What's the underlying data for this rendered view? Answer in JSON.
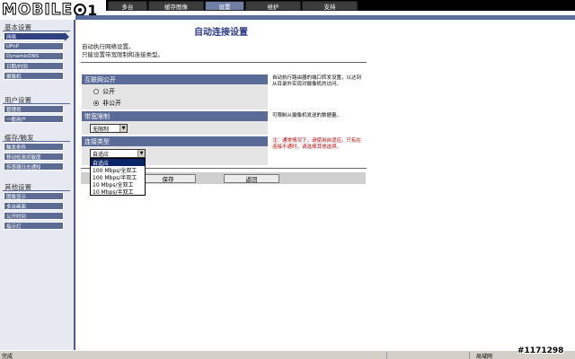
{
  "header": {
    "logo_text": "MOBILE",
    "logo_digit": "1",
    "tabs": [
      {
        "label": "多台"
      },
      {
        "label": "缓存图像"
      },
      {
        "label": "设置"
      },
      {
        "label": "维护"
      },
      {
        "label": "支持"
      }
    ]
  },
  "sidebar": {
    "sections": [
      {
        "title": "基本设置",
        "items": [
          {
            "label": "网络"
          },
          {
            "label": "UPnP"
          },
          {
            "label": "DynamicDNS"
          },
          {
            "label": "日期/时间"
          },
          {
            "label": "摄像机"
          }
        ]
      },
      {
        "title": "用户设置",
        "items": [
          {
            "label": "管理员"
          },
          {
            "label": "一般用户"
          }
        ]
      },
      {
        "title": "缓存/触发",
        "items": [
          {
            "label": "触发条件"
          },
          {
            "label": "移动检测灵敏度"
          },
          {
            "label": "传感器日志通知"
          }
        ]
      },
      {
        "title": "其他设置",
        "items": [
          {
            "label": "图像显示"
          },
          {
            "label": "多台画面"
          },
          {
            "label": "公开时间"
          },
          {
            "label": "指示灯"
          }
        ]
      }
    ]
  },
  "main": {
    "title": "自动连接设置",
    "desc1": "自动执行网络设置。",
    "desc2": "只能设置带宽限制和连接类型。",
    "public": {
      "header": "互联网公开",
      "options": [
        "公开",
        "非公开"
      ],
      "selected": "非公开",
      "help": "自动执行路由器的端口转发设置，以达到从目录外实现对摄像机的访问。"
    },
    "bandwidth": {
      "header": "带宽限制",
      "value": "无限制",
      "help": "可限制从摄像机发送的数据量。"
    },
    "connection": {
      "header": "连接类型",
      "value": "自适应",
      "options": [
        "自适应",
        "100 Mbps/全双工",
        "100 Mbps/半双工",
        "10 Mbps/全双工",
        "10 Mbps/半双工"
      ],
      "help": "注：通常情况下，请使用自适应。只有在连接不通时，请选择其他选项。"
    },
    "save_label": "保存",
    "back_label": "返回"
  },
  "statusbar": {
    "text": "完成",
    "zone": "局域网",
    "watermark": "#1171298"
  }
}
